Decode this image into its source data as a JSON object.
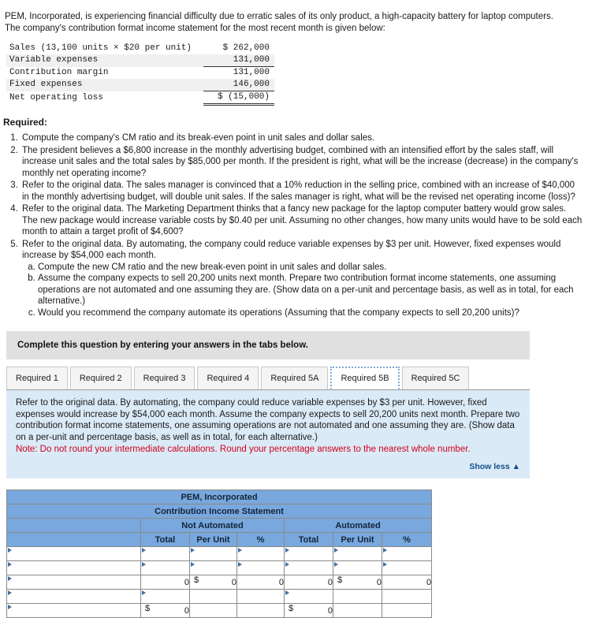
{
  "intro": {
    "paragraph": "PEM, Incorporated, is experiencing financial difficulty due to erratic sales of its only product, a high-capacity battery for laptop computers. The company's contribution format income statement for the most recent month is given below:"
  },
  "income_statement": {
    "rows": [
      {
        "label": "Sales (13,100 units × $20 per unit)",
        "amount": "$ 262,000"
      },
      {
        "label": "Variable expenses",
        "amount": "131,000"
      },
      {
        "label": "Contribution margin",
        "amount": "131,000"
      },
      {
        "label": "Fixed expenses",
        "amount": "146,000"
      },
      {
        "label": "Net operating loss",
        "amount": "$ (15,000)"
      }
    ]
  },
  "required": {
    "heading": "Required:",
    "items": [
      "Compute the company's CM ratio and its break-even point in unit sales and dollar sales.",
      "The president believes a $6,800 increase in the monthly advertising budget, combined with an intensified effort by the sales staff, will increase unit sales and the total sales by $85,000 per month. If the president is right, what will be the increase (decrease) in the company's monthly net operating income?",
      "Refer to the original data. The sales manager is convinced that a 10% reduction in the selling price, combined with an increase of $40,000 in the monthly advertising budget, will double unit sales. If the sales manager is right, what will be the revised net operating income (loss)?",
      "Refer to the original data. The Marketing Department thinks that a fancy new package for the laptop computer battery would grow sales. The new package would increase variable costs by $0.40 per unit. Assuming no other changes, how many units would have to be sold each month to attain a target profit of $4,600?",
      "Refer to the original data. By automating, the company could reduce variable expenses by $3 per unit. However, fixed expenses would increase by $54,000 each month."
    ],
    "sub_items": [
      "Compute the new CM ratio and the new break-even point in unit sales and dollar sales.",
      "Assume the company expects to sell 20,200 units next month. Prepare two contribution format income statements, one assuming operations are not automated and one assuming they are. (Show data on a per-unit and percentage basis, as well as in total, for each alternative.)",
      "Would you recommend the company automate its operations (Assuming that the company expects to sell 20,200 units)?"
    ]
  },
  "complete_bar": {
    "text": "Complete this question by entering your answers in the tabs below."
  },
  "tabs": {
    "items": [
      {
        "label": "Required 1",
        "active": false
      },
      {
        "label": "Required 2",
        "active": false
      },
      {
        "label": "Required 3",
        "active": false
      },
      {
        "label": "Required 4",
        "active": false
      },
      {
        "label": "Required 5A",
        "active": false
      },
      {
        "label": "Required 5B",
        "active": true
      },
      {
        "label": "Required 5C",
        "active": false
      }
    ]
  },
  "instruction": {
    "body": "Refer to the original data. By automating, the company could reduce variable expenses by $3 per unit. However, fixed expenses would increase by $54,000 each month. Assume the company expects to sell 20,200 units next month. Prepare two contribution format income statements, one assuming operations are not automated and one assuming they are. (Show data on a per-unit and percentage basis, as well as in total, for each alternative.)",
    "note": "Note: Do not round your intermediate calculations. Round your percentage answers to the nearest whole number.",
    "show_less": "Show less ▲"
  },
  "answer_table": {
    "title": "PEM, Incorporated",
    "subtitle": "Contribution Income Statement",
    "group_headers": [
      "Not Automated",
      "Automated"
    ],
    "column_headers": [
      "Total",
      "Per Unit",
      "%",
      "Total",
      "Per Unit",
      "%"
    ],
    "rows": [
      {
        "label": "",
        "cells": [
          "",
          "",
          "",
          "",
          "",
          ""
        ],
        "types": [
          "inp",
          "inp",
          "inp",
          "inp",
          "inp",
          "inp"
        ]
      },
      {
        "label": "",
        "cells": [
          "",
          "",
          "",
          "",
          "",
          ""
        ],
        "types": [
          "inp",
          "inp",
          "inp",
          "inp",
          "inp",
          "inp"
        ]
      },
      {
        "label": "",
        "cells": [
          "0",
          "0",
          "0",
          "0",
          "0",
          "0"
        ],
        "types": [
          "num",
          "num-d",
          "num",
          "num",
          "num-d",
          "num"
        ]
      },
      {
        "label": "",
        "cells": [
          "",
          "",
          "",
          "",
          "",
          ""
        ],
        "types": [
          "inp",
          "plain",
          "plain",
          "inp",
          "plain",
          "plain"
        ]
      },
      {
        "label": "",
        "cells": [
          "0",
          "",
          "",
          "0",
          "",
          ""
        ],
        "types": [
          "num-d",
          "plain",
          "plain",
          "num-d",
          "plain",
          "plain"
        ]
      }
    ],
    "dollar_sign": "$"
  },
  "colors": {
    "header_blue": "#78a8dd",
    "instruction_blue": "#dbeaf7",
    "note_red": "#d0021b",
    "link_blue": "#14508c",
    "gray_bar": "#e0e0e0"
  }
}
